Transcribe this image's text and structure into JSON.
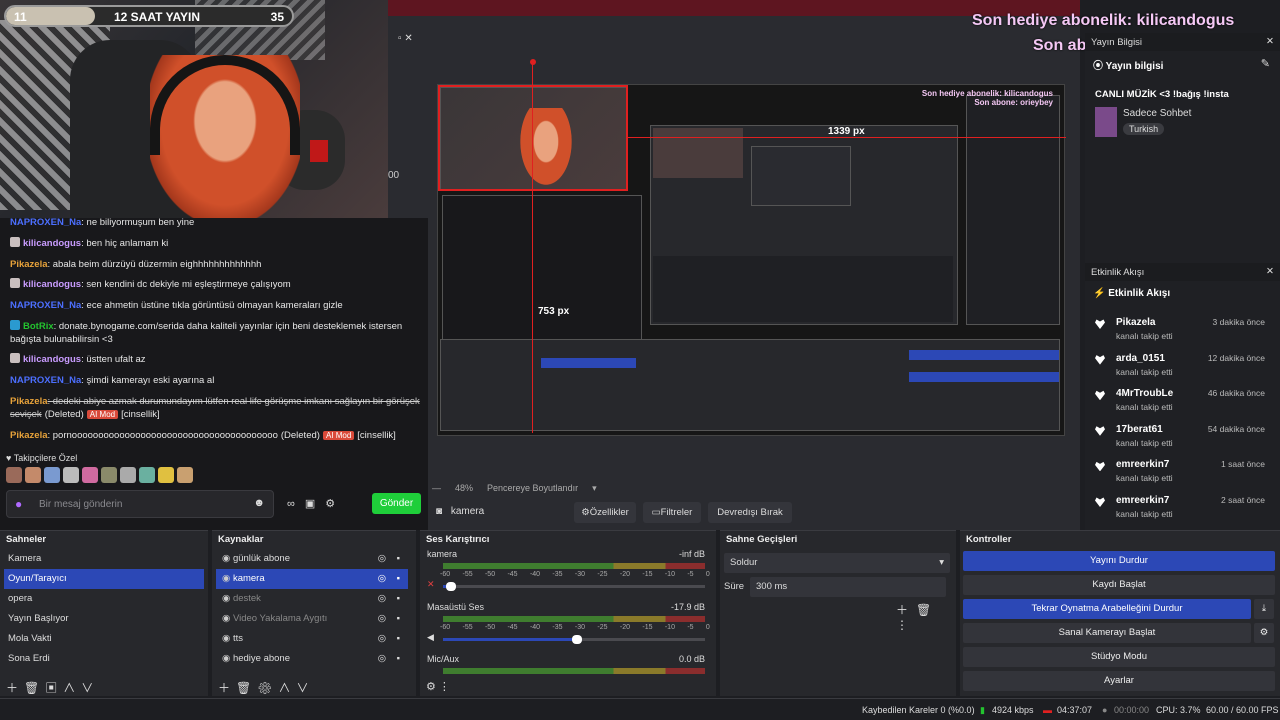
{
  "overlay": {
    "goal_left": "11",
    "goal_title": "12 SAAT YAYIN",
    "goal_right": "35",
    "goal_progress": 0.31,
    "last_gift_sub": "Son hediye abonelik: kilicandogus",
    "last_sub": "Son abone: orieybey"
  },
  "preview": {
    "px_label_1": "753 px",
    "px_label_2": "1339 px",
    "zoom": "48%",
    "resize_label": "Pencereye Boyutlandır",
    "timestamp_fragment": "00"
  },
  "chat": {
    "messages": [
      {
        "user": "NAPROXEN_Na",
        "text": ": ne biliyormuşum ben yine"
      },
      {
        "user": "kilicandogus",
        "text": ": ben hiç anlamam ki"
      },
      {
        "user": "Pikazela",
        "text": ": abala beim dürzüyü düzermin eighhhhhhhhhhhhh"
      },
      {
        "user": "kilicandogus",
        "text": ": sen kendini dc dekiyle mi eşleştirmeye çalışıyom"
      },
      {
        "user": "NAPROXEN_Na",
        "text": ": ece ahmetin üstüne tıkla görüntüsü olmayan kameraları gizle"
      },
      {
        "user": "BotRix",
        "text": ": donate.bynogame.com/serida daha kaliteli yayınlar için beni desteklemek istersen",
        "text2": "bağışta bulunabilirsin <3"
      },
      {
        "user": "kilicandogus",
        "text": ": üstten ufalt az"
      },
      {
        "user": "NAPROXEN_Na",
        "text": ": şimdi kamerayı eski ayarına al"
      },
      {
        "user": "Pikazela",
        "text": ": dedeki abiye azmak durumundayım lütfen real life görüşme imkanı sağlayın bir görüşek",
        "text2": "sevişek",
        "deleted": "(Deleted)",
        "mod": "AI Mod",
        "tag": "[cinsellik]"
      },
      {
        "user": "Pikazela",
        "text": ": pornooooooooooooooooooooooooooooooooooooooo",
        "deleted": "(Deleted)",
        "mod": "AI Mod",
        "tag": "[cinsellik]"
      }
    ],
    "followers_label": "Takipçilere Özel",
    "input_placeholder": "Bir mesaj gönderin",
    "send_label": "Gönder"
  },
  "right_dock": {
    "stream_info_header": "Yayın Bilgisi",
    "stream_info_title": "Yayın bilgisi",
    "stream_title": "CANLI MÜZİK <3 !bağış !insta",
    "category": "Sadece Sohbet",
    "language": "Turkish",
    "events_header": "Etkinlik Akışı",
    "events_title": "Etkinlik Akışı",
    "events": [
      {
        "name": "Pikazela",
        "sub": "kanalı takip etti",
        "time": "3 dakika önce"
      },
      {
        "name": "arda_0151",
        "sub": "kanalı takip etti",
        "time": "12 dakika önce"
      },
      {
        "name": "4MrTroubLe",
        "sub": "kanalı takip etti",
        "time": "46 dakika önce"
      },
      {
        "name": "17berat61",
        "sub": "kanalı takip etti",
        "time": "54 dakika önce"
      },
      {
        "name": "emreerkin7",
        "sub": "kanalı takip etti",
        "time": "1 saat önce"
      },
      {
        "name": "emreerkin7",
        "sub": "kanalı takip etti",
        "time": "2 saat önce"
      }
    ]
  },
  "source_toolbar": {
    "source_name": "kamera",
    "properties": "Özellikler",
    "filters": "Filtreler",
    "deactivate": "Devredışı Bırak"
  },
  "scenes": {
    "title": "Sahneler",
    "items": [
      "Kamera",
      "Oyun/Tarayıcı",
      "opera",
      "Yayın Başlıyor",
      "Mola Vakti",
      "Sona Erdi"
    ],
    "selected": 1
  },
  "sources": {
    "title": "Kaynaklar",
    "items": [
      "günlük abone",
      "kamera",
      "destek",
      "Video Yakalama Aygıtı",
      "tts",
      "hediye abone"
    ],
    "selected": 1
  },
  "mixer": {
    "title": "Ses Karıştırıcı",
    "tracks": [
      {
        "name": "kamera",
        "db": "-inf dB",
        "volume": 0.03
      },
      {
        "name": "Masaüstü Ses",
        "db": "-17.9 dB",
        "volume": 0.51
      },
      {
        "name": "Mic/Aux",
        "db": "0.0 dB",
        "volume": 1.0
      }
    ],
    "scale": [
      "-60",
      "-55",
      "-50",
      "-45",
      "-40",
      "-35",
      "-30",
      "-25",
      "-20",
      "-15",
      "-10",
      "-5",
      "0"
    ]
  },
  "transitions": {
    "title": "Sahne Geçişleri",
    "selected": "Soldur",
    "duration_label": "Süre",
    "duration": "300 ms"
  },
  "controls": {
    "title": "Kontroller",
    "stop_stream": "Yayını Durdur",
    "start_record": "Kaydı Başlat",
    "stop_replay": "Tekrar Oynatma Arabelleğini Durdur",
    "virtual_cam": "Sanal Kamerayı Başlat",
    "studio_mode": "Stüdyo Modu",
    "settings": "Ayarlar"
  },
  "status": {
    "dropped": "Kaybedilen Kareler 0 (%0.0)",
    "bitrate": "4924 kbps",
    "live_time": "04:37:07",
    "rec_time": "00:00:00",
    "cpu": "CPU: 3.7%",
    "fps": "60.00 / 60.00 FPS"
  },
  "colors": {
    "accent": "#2c48b6",
    "send": "#1fce3a",
    "titlebar": "#5e1520",
    "overlay_text": "#f5c8f5"
  }
}
